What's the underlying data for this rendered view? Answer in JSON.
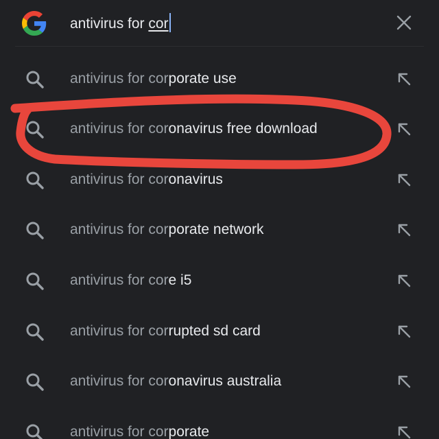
{
  "search": {
    "typed_prefix": "antivirus for ",
    "typed_underlined": "cor",
    "icon": "google-g-logo",
    "clear_icon": "close-icon"
  },
  "suggestions": [
    {
      "pre": "antivirus for cor",
      "post": "porate use"
    },
    {
      "pre": "antivirus for cor",
      "post": "onavirus free download"
    },
    {
      "pre": "antivirus for cor",
      "post": "onavirus"
    },
    {
      "pre": "antivirus for cor",
      "post": "porate network"
    },
    {
      "pre": "antivirus for cor",
      "post": "e i5"
    },
    {
      "pre": "antivirus for cor",
      "post": "rupted sd card"
    },
    {
      "pre": "antivirus for cor",
      "post": "onavirus australia"
    },
    {
      "pre": "antivirus for cor",
      "post": "porate"
    }
  ],
  "suggestion_icon": "search-icon",
  "fill_icon": "arrow-up-left-icon",
  "annotation": {
    "color": "#e8463c",
    "circled_suggestion": 2
  },
  "colors": {
    "background": "#202124",
    "query_text": "#e8eaed",
    "prefix_text": "#9aa0a6",
    "caret": "#8ab4f8"
  }
}
